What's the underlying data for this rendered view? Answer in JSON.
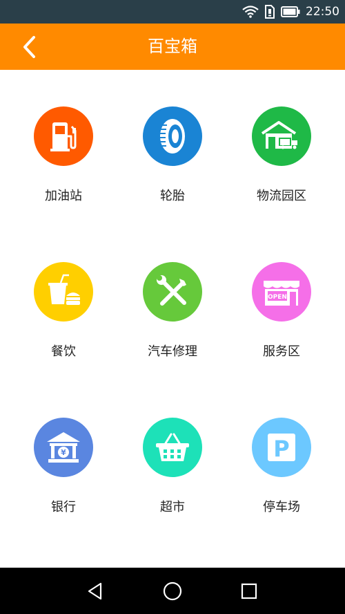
{
  "status_bar": {
    "time": "22:50",
    "icons": [
      "wifi-icon",
      "sim-card-icon",
      "battery-icon"
    ]
  },
  "header": {
    "title": "百宝箱",
    "back_icon": "chevron-left-icon",
    "background_color": "#ff8a00"
  },
  "tiles": [
    {
      "label": "加油站",
      "icon": "gas-pump-icon",
      "color": "#ff5a00"
    },
    {
      "label": "轮胎",
      "icon": "tire-icon",
      "color": "#1a84d4"
    },
    {
      "label": "物流园区",
      "icon": "warehouse-truck-icon",
      "color": "#1fb947"
    },
    {
      "label": "餐饮",
      "icon": "drink-burger-icon",
      "color": "#ffcf00"
    },
    {
      "label": "汽车修理",
      "icon": "wrench-screwdriver-icon",
      "color": "#66c93b"
    },
    {
      "label": "服务区",
      "icon": "open-shop-icon",
      "color": "#f56fe8"
    },
    {
      "label": "银行",
      "icon": "bank-icon",
      "color": "#5a86e0"
    },
    {
      "label": "超市",
      "icon": "shopping-basket-icon",
      "color": "#1de1b8"
    },
    {
      "label": "停车场",
      "icon": "parking-icon",
      "color": "#6cc8ff"
    }
  ],
  "nav_bar": {
    "icons": [
      "back-triangle-icon",
      "home-circle-icon",
      "recents-square-icon"
    ]
  }
}
